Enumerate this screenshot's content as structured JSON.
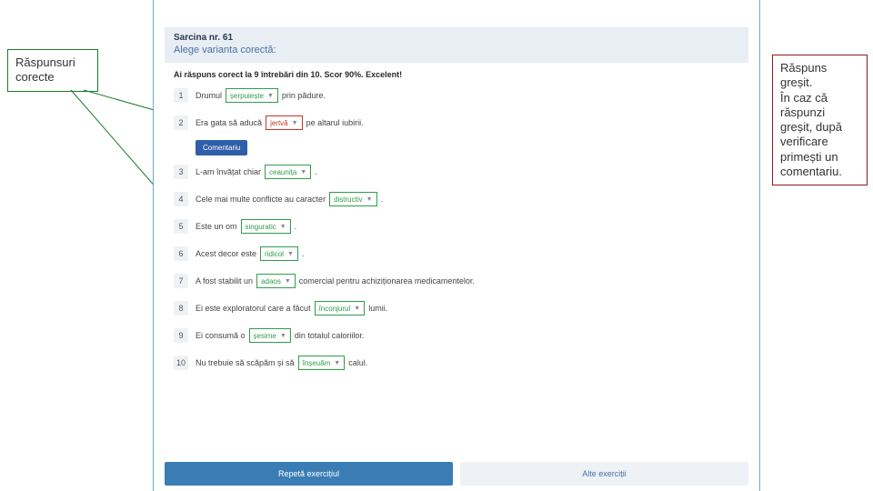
{
  "callouts": {
    "left": "Răspunsuri corecte",
    "right": "Răspuns greșit.\nÎn caz că răspunzi greșit, după verificare primești un comentariu."
  },
  "task": {
    "number_label": "Sarcina nr. 61",
    "title": "Alege varianta corectă:"
  },
  "score_line": "Ai răspuns corect la 9 întrebări din 10. Scor 90%. Excelent!",
  "comment_btn": "Comentariu",
  "questions": [
    {
      "n": "1",
      "pre": "Drumul",
      "dd": "șerpuiește",
      "state": "green",
      "post": "prin pădure."
    },
    {
      "n": "2",
      "pre": "Era gata să aducă",
      "dd": "jertvă",
      "state": "red",
      "post": "pe altarul iubirii."
    },
    {
      "n": "3",
      "pre": "L-am învățat chiar",
      "dd": "ceaunița",
      "state": "green",
      "post": "."
    },
    {
      "n": "4",
      "pre": "Cele mai multe conflicte au caracter",
      "dd": "distructiv",
      "state": "green",
      "post": "."
    },
    {
      "n": "5",
      "pre": "Este un om",
      "dd": "singuratic",
      "state": "green",
      "post": "."
    },
    {
      "n": "6",
      "pre": "Acest decor este",
      "dd": "ridicol",
      "state": "green",
      "post": "."
    },
    {
      "n": "7",
      "pre": "A fost stabilit un",
      "dd": "adaos",
      "state": "green",
      "post": "comercial pentru achiziționarea medicamentelor."
    },
    {
      "n": "8",
      "pre": "Ei este exploratorul care a făcut",
      "dd": "înconjurul",
      "state": "green",
      "post": "lumii."
    },
    {
      "n": "9",
      "pre": "Ei consumă o",
      "dd": "șesime",
      "state": "green",
      "post": "din totalul caloriilor."
    },
    {
      "n": "10",
      "pre": "Nu trebuie să scăpăm și să",
      "dd": "înșeuăm",
      "state": "green",
      "post": "calul."
    }
  ],
  "footer": {
    "repeat": "Repetă exercițiul",
    "other": "Alte exerciții"
  }
}
